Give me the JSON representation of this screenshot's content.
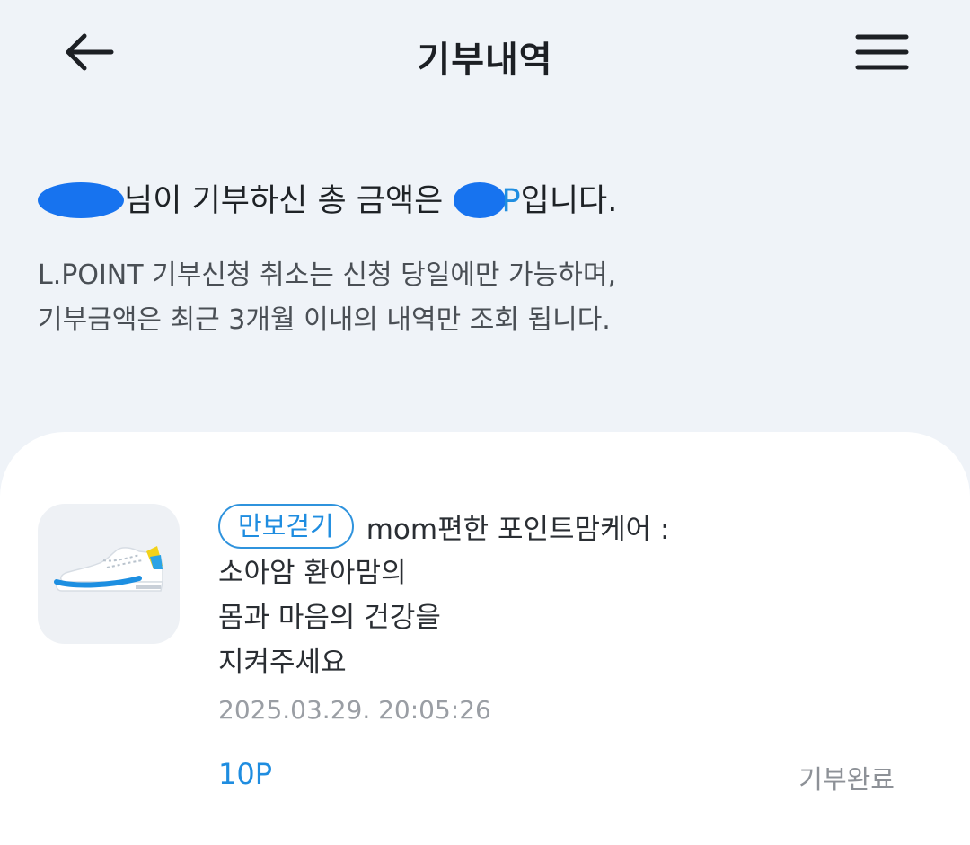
{
  "header": {
    "title": "기부내역",
    "back_icon": "arrow-left-icon",
    "menu_icon": "hamburger-menu-icon"
  },
  "summary": {
    "suffix_name": "님이 기부하신 총 금액은 ",
    "amount_unit": "P",
    "suffix_end": "입니다."
  },
  "notice": {
    "line1": "L.POINT 기부신청 취소는 신청 당일에만 가능하며,",
    "line2": "기부금액은 최근 3개월 이내의 내역만 조회 됩니다."
  },
  "donation_item": {
    "tag": "만보걷기",
    "title_first": "mom편한 포인트맘케어 :",
    "title_lines": [
      "소아암 환아맘의",
      "몸과 마음의 건강을",
      "지켜주세요"
    ],
    "date": "2025.03.29. 20:05:26",
    "points": "10P",
    "status": "기부완료",
    "thumb_icon": "sneaker-icon"
  },
  "colors": {
    "accent": "#1f8de0",
    "background": "#eff3f8",
    "redaction": "#1773ef"
  }
}
